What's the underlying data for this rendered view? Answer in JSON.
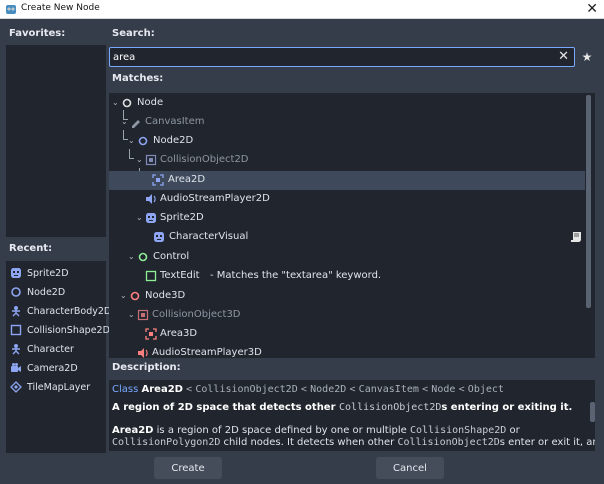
{
  "window": {
    "title": "Create New Node",
    "close_glyph": "✕"
  },
  "favorites": {
    "heading": "Favorites:"
  },
  "recent": {
    "heading": "Recent:",
    "items": [
      {
        "label": "Sprite2D",
        "icon": "sprite2d-icon"
      },
      {
        "label": "Node2D",
        "icon": "node2d-icon"
      },
      {
        "label": "CharacterBody2D",
        "icon": "characterbody2d-icon"
      },
      {
        "label": "CollisionShape2D",
        "icon": "collisionshape2d-icon"
      },
      {
        "label": "Character",
        "icon": "character-icon"
      },
      {
        "label": "Camera2D",
        "icon": "camera2d-icon"
      },
      {
        "label": "TileMapLayer",
        "icon": "tilemaplayer-icon"
      }
    ]
  },
  "search": {
    "heading": "Search:",
    "value": "area",
    "placeholder": "",
    "clear_glyph": "✕",
    "favorite_glyph": "★"
  },
  "matches": {
    "heading": "Matches:",
    "rows": [
      {
        "label": "Node",
        "icon": "node-icon",
        "dim": false,
        "selected": false
      },
      {
        "label": "CanvasItem",
        "icon": "canvasitem-icon",
        "dim": true,
        "selected": false
      },
      {
        "label": "Node2D",
        "icon": "node2d-icon",
        "dim": false,
        "selected": false
      },
      {
        "label": "CollisionObject2D",
        "icon": "collisionobject2d-icon",
        "dim": true,
        "selected": false
      },
      {
        "label": "Area2D",
        "icon": "area2d-icon",
        "dim": false,
        "selected": true
      },
      {
        "label": "AudioStreamPlayer2D",
        "icon": "audiostreamplayer2d-icon",
        "dim": false,
        "selected": false
      },
      {
        "label": "Sprite2D",
        "icon": "sprite2d-icon",
        "dim": false,
        "selected": false
      },
      {
        "label": "CharacterVisual",
        "icon": "charactervisual-icon",
        "dim": false,
        "selected": false
      },
      {
        "label": "Control",
        "icon": "control-icon",
        "dim": false,
        "selected": false
      },
      {
        "label": "TextEdit",
        "icon": "textedit-icon",
        "dim": false,
        "selected": false,
        "hint": "- Matches the \"textarea\" keyword."
      },
      {
        "label": "Node3D",
        "icon": "node3d-icon",
        "dim": false,
        "selected": false
      },
      {
        "label": "CollisionObject3D",
        "icon": "collisionobject3d-icon",
        "dim": true,
        "selected": false
      },
      {
        "label": "Area3D",
        "icon": "area3d-icon",
        "dim": false,
        "selected": false
      },
      {
        "label": "AudioStreamPlayer3D",
        "icon": "audiostreamplayer3d-icon",
        "dim": false,
        "selected": false
      }
    ]
  },
  "description": {
    "heading": "Description:",
    "class_word": "Class",
    "class_name": "Area2D",
    "inheritance": [
      "CollisionObject2D",
      "Node2D",
      "CanvasItem",
      "Node",
      "Object"
    ],
    "inherit_sep": "<",
    "brief_text_1": "A region of 2D space that detects other ",
    "brief_code": "CollisionObject2D",
    "brief_text_2": "s entering or exiting it.",
    "line1_name": "Area2D",
    "line1_text": " is a region of 2D space defined by one or multiple ",
    "line1_code": "CollisionShape2D",
    "line1_or": " or",
    "line2_code": "CollisionPolygon2D",
    "line2_text": " child nodes. It detects when other ",
    "line2_code2": "CollisionObject2D",
    "line2_text2": "s enter or exit it, and it"
  },
  "buttons": {
    "create": "Create",
    "cancel": "Cancel"
  },
  "colors": {
    "accent": "#78a9ff",
    "node2d": "#8da5f3",
    "control": "#8eef97",
    "node3d": "#fc7f7f",
    "selected_row": "#3e4a5c"
  }
}
